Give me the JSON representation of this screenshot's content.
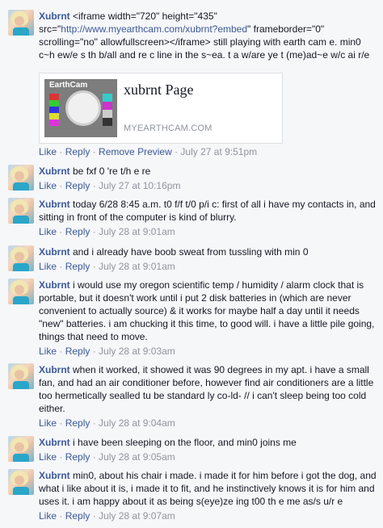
{
  "actions": {
    "like": "Like",
    "reply": "Reply",
    "remove_preview": "Remove Preview",
    "sep": " · "
  },
  "preview": {
    "title": "xubrnt Page",
    "domain": "MYEARTHCAM.COM",
    "logo": "EarthCam"
  },
  "comments": [
    {
      "author": "Xubrnt",
      "text_before": " <iframe width=\"720\" height=\"435\" src=\"",
      "link": "http://www.myearthcam.com/xubrnt?embed",
      "text_after": "\" frameborder=\"0\" scrolling=\"no\" allowfullscreen></iframe> still playing with earth cam e. min0 c~h ew/e s th b/all and re c line in the s~ea. t a w/are ye t (me)ad~e w/c ai r/e",
      "time": "July 27 at 9:51pm"
    },
    {
      "author": "Xubrnt",
      "text": " be fxf 0 're t/h e re",
      "time": "July 27 at 10:16pm"
    },
    {
      "author": "Xubrnt",
      "text": " today 6/28 8:45 a.m. t0 f/f t/0 p/i c: first of all i have my contacts in, and sitting in front of the computer is kind of blurry.",
      "time": "July 28 at 9:01am"
    },
    {
      "author": "Xubrnt",
      "text": " and i already have boob sweat from tussling with min 0",
      "time": "July 28 at 9:01am"
    },
    {
      "author": "Xubrnt",
      "text": " i would use my oregon scientific temp / humidity / alarm clock that is portable, but it doesn't work until i put 2 disk batteries in (which are never convenient to actually source) & it works for maybe half a day until it needs \"new\" batteries. i am chucking it this time, to good will. i have a little pile going, things that need to move.",
      "time": "July 28 at 9:03am"
    },
    {
      "author": "Xubrnt",
      "text": " when it worked, it showed it was 90 degrees in my apt. i have a small fan, and had an air conditioner before, however find air conditioners are a little too hermetically sealled tu be standard ly co-ld- // i can't sleep being too cold either.",
      "time": "July 28 at 9:04am"
    },
    {
      "author": "Xubrnt",
      "text": " i have been sleeping on the floor, and min0 joins me",
      "time": "July 28 at 9:05am"
    },
    {
      "author": "Xubrnt",
      "text": " min0, about his chair i made. i made it for him before i got the dog, and what i like about it is, i made it to fit, and he instinctively knows it is for him and uses it. i am happy about it as being s(eye)ze ing t00 th e me as/s u/r e",
      "time": "July 28 at 9:07am"
    }
  ]
}
